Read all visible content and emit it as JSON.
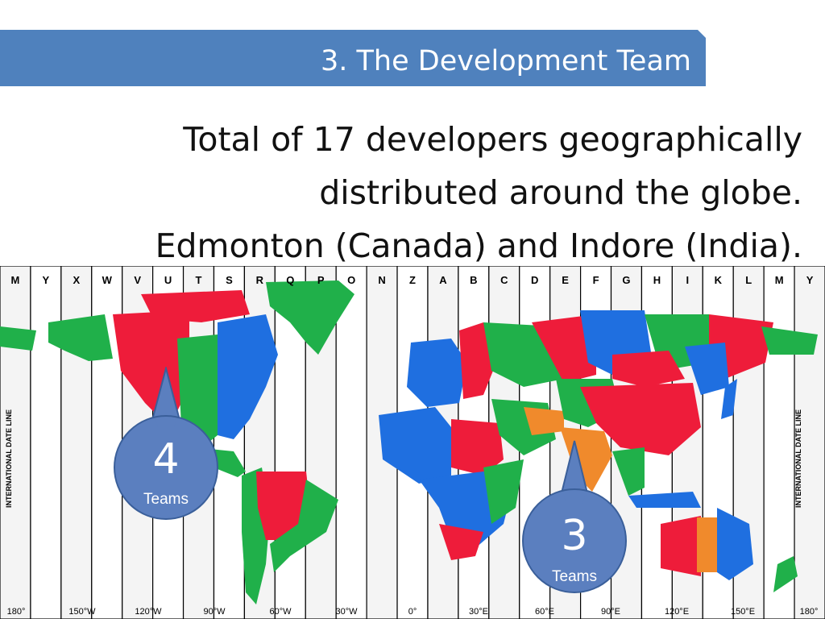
{
  "slide": {
    "title": "3. The Development Team",
    "lines": [
      "Total of 17 developers geographically",
      "distributed around the globe.",
      "Edmonton (Canada) and Indore (India)."
    ]
  },
  "map": {
    "zone_letters": [
      "M",
      "Y",
      "X",
      "W",
      "V",
      "U",
      "T",
      "S",
      "R",
      "Q",
      "P",
      "O",
      "N",
      "Z",
      "A",
      "B",
      "C",
      "D",
      "E",
      "F",
      "G",
      "H",
      "I",
      "K",
      "L",
      "M",
      "Y"
    ],
    "longitude_labels": [
      "180°",
      "150°W",
      "120°W",
      "90°W",
      "60°W",
      "30°W",
      "0°",
      "30°E",
      "60°E",
      "90°E",
      "120°E",
      "150°E",
      "180°"
    ],
    "date_line_label": "INTERNATIONAL DATE LINE"
  },
  "callouts": [
    {
      "count": "4",
      "label": "Teams",
      "color": "#5b7fbf"
    },
    {
      "count": "3",
      "label": "Teams",
      "color": "#5b7fbf"
    }
  ],
  "colors": {
    "banner": "#4f81bd",
    "country_red": "#ee1c3a",
    "country_blue": "#1f6fe0",
    "country_green": "#20b04a",
    "country_orange": "#f08a2c",
    "country_olive": "#808000",
    "zone_stripe": "#f2f2f2"
  }
}
